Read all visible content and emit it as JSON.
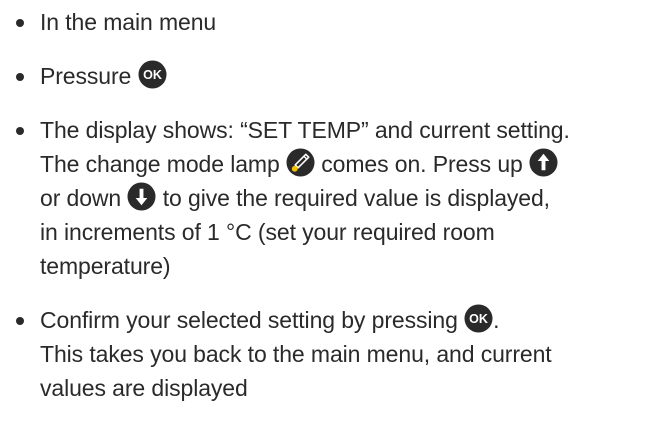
{
  "steps": [
    {
      "text": "In the main menu"
    },
    {
      "text_before": "Pressure",
      "ok_label": "OK"
    },
    {
      "part1": "The display shows: “SET TEMP” and current setting.",
      "part2": "The change mode lamp",
      "part3": "comes on. Press up",
      "part4": "or down",
      "part5": "to give the required value is displayed,",
      "part6": "in increments of 1 °C (set your required room",
      "part7": "temperature)"
    },
    {
      "part1": "Confirm your selected setting by pressing",
      "ok_label": "OK",
      "part2": ".",
      "part3": "This takes you back to the main menu, and current",
      "part4": "values are displayed"
    }
  ],
  "colors": {
    "text": "#2a2a2a",
    "icon_dark": "#2a2a2a",
    "lamp_dot": "#f2c200"
  },
  "icons": [
    "ok-button-icon",
    "change-mode-lamp-icon",
    "arrow-up-icon",
    "arrow-down-icon"
  ]
}
